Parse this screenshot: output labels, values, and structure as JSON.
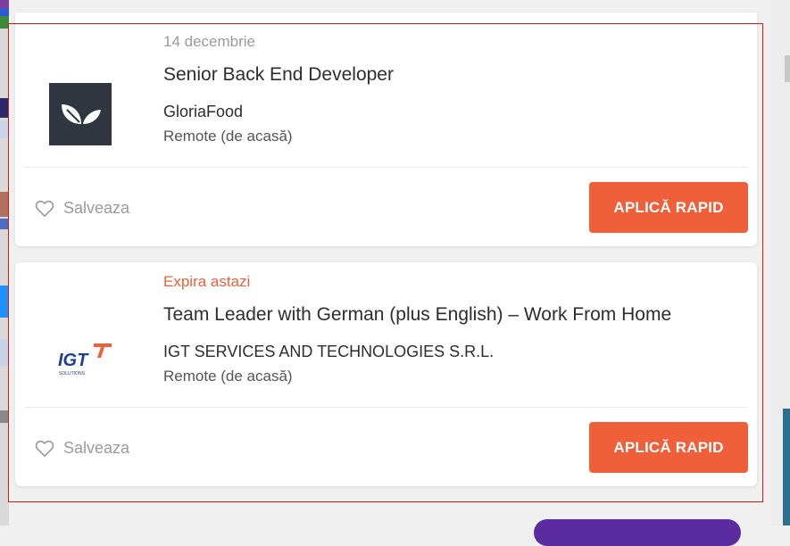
{
  "jobs": [
    {
      "date": "14 decembrie",
      "title": "Senior Back End Developer",
      "company": "GloriaFood",
      "location": "Remote (de acasă)",
      "save_label": "Salveaza",
      "apply_label": "APLICĂ RAPID",
      "logo_icon": "gloriafood-leaf-icon"
    },
    {
      "date": "Expira astazi",
      "title": "Team Leader with German (plus English) – Work From Home",
      "company": "IGT SERVICES AND TECHNOLOGIES S.R.L.",
      "location": "Remote (de acasă)",
      "save_label": "Salveaza",
      "apply_label": "APLICĂ RAPID",
      "logo_icon": "igt-solutions-logo",
      "logo_text": "IGT",
      "logo_subtext": "SOLUTIONS"
    }
  ],
  "colors": {
    "accent": "#ee5f3a",
    "selection_border": "#d01a1a",
    "expire_text": "#ee5f3a",
    "muted_text": "#9a9a9a"
  }
}
